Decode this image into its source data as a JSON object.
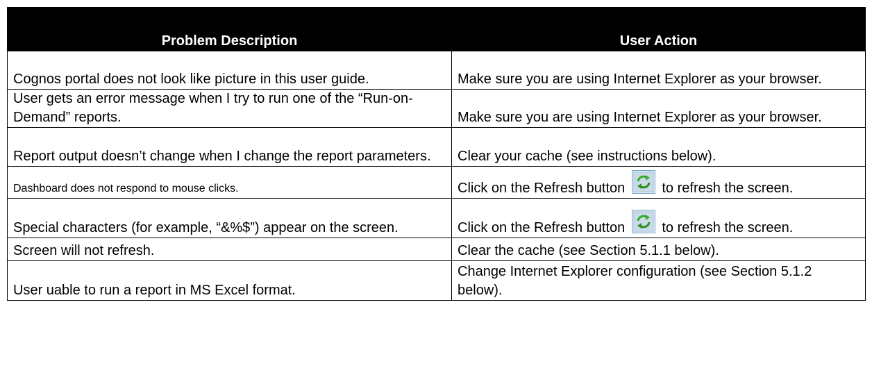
{
  "table": {
    "headers": [
      "Problem Description",
      "User Action"
    ],
    "rows": [
      {
        "problem": "Cognos portal does not look like picture in this user guide.",
        "action": "Make sure you are using Internet Explorer as your browser."
      },
      {
        "problem": "User gets an error message when I try to run one of the “Run-on-Demand” reports.",
        "action": "Make sure you are using Internet Explorer as your browser."
      },
      {
        "problem": "Report output doesn’t change when I change the report parameters.",
        "action": "Clear your cache (see instructions below)."
      },
      {
        "problem": "Dashboard does not respond to mouse clicks.",
        "action_before": "Click on the Refresh button",
        "action_after": "to refresh the screen."
      },
      {
        "problem": "Special characters (for example, “&%$”) appear on the screen.",
        "action_before": "Click on the Refresh button",
        "action_after": "to refresh the screen."
      },
      {
        "problem": "Screen will not refresh.",
        "action": "Clear the cache (see Section 5.1.1 below)."
      },
      {
        "problem": "User uable to run a report in MS Excel format.",
        "action": "Change Internet Explorer configuration (see Section 5.1.2 below)."
      }
    ]
  },
  "icons": {
    "refresh": "refresh-icon"
  },
  "colors": {
    "header_bg": "#000000",
    "header_text": "#ffffff",
    "icon_frame": "#7aa6c8",
    "icon_arrows": "#3aa82a"
  }
}
